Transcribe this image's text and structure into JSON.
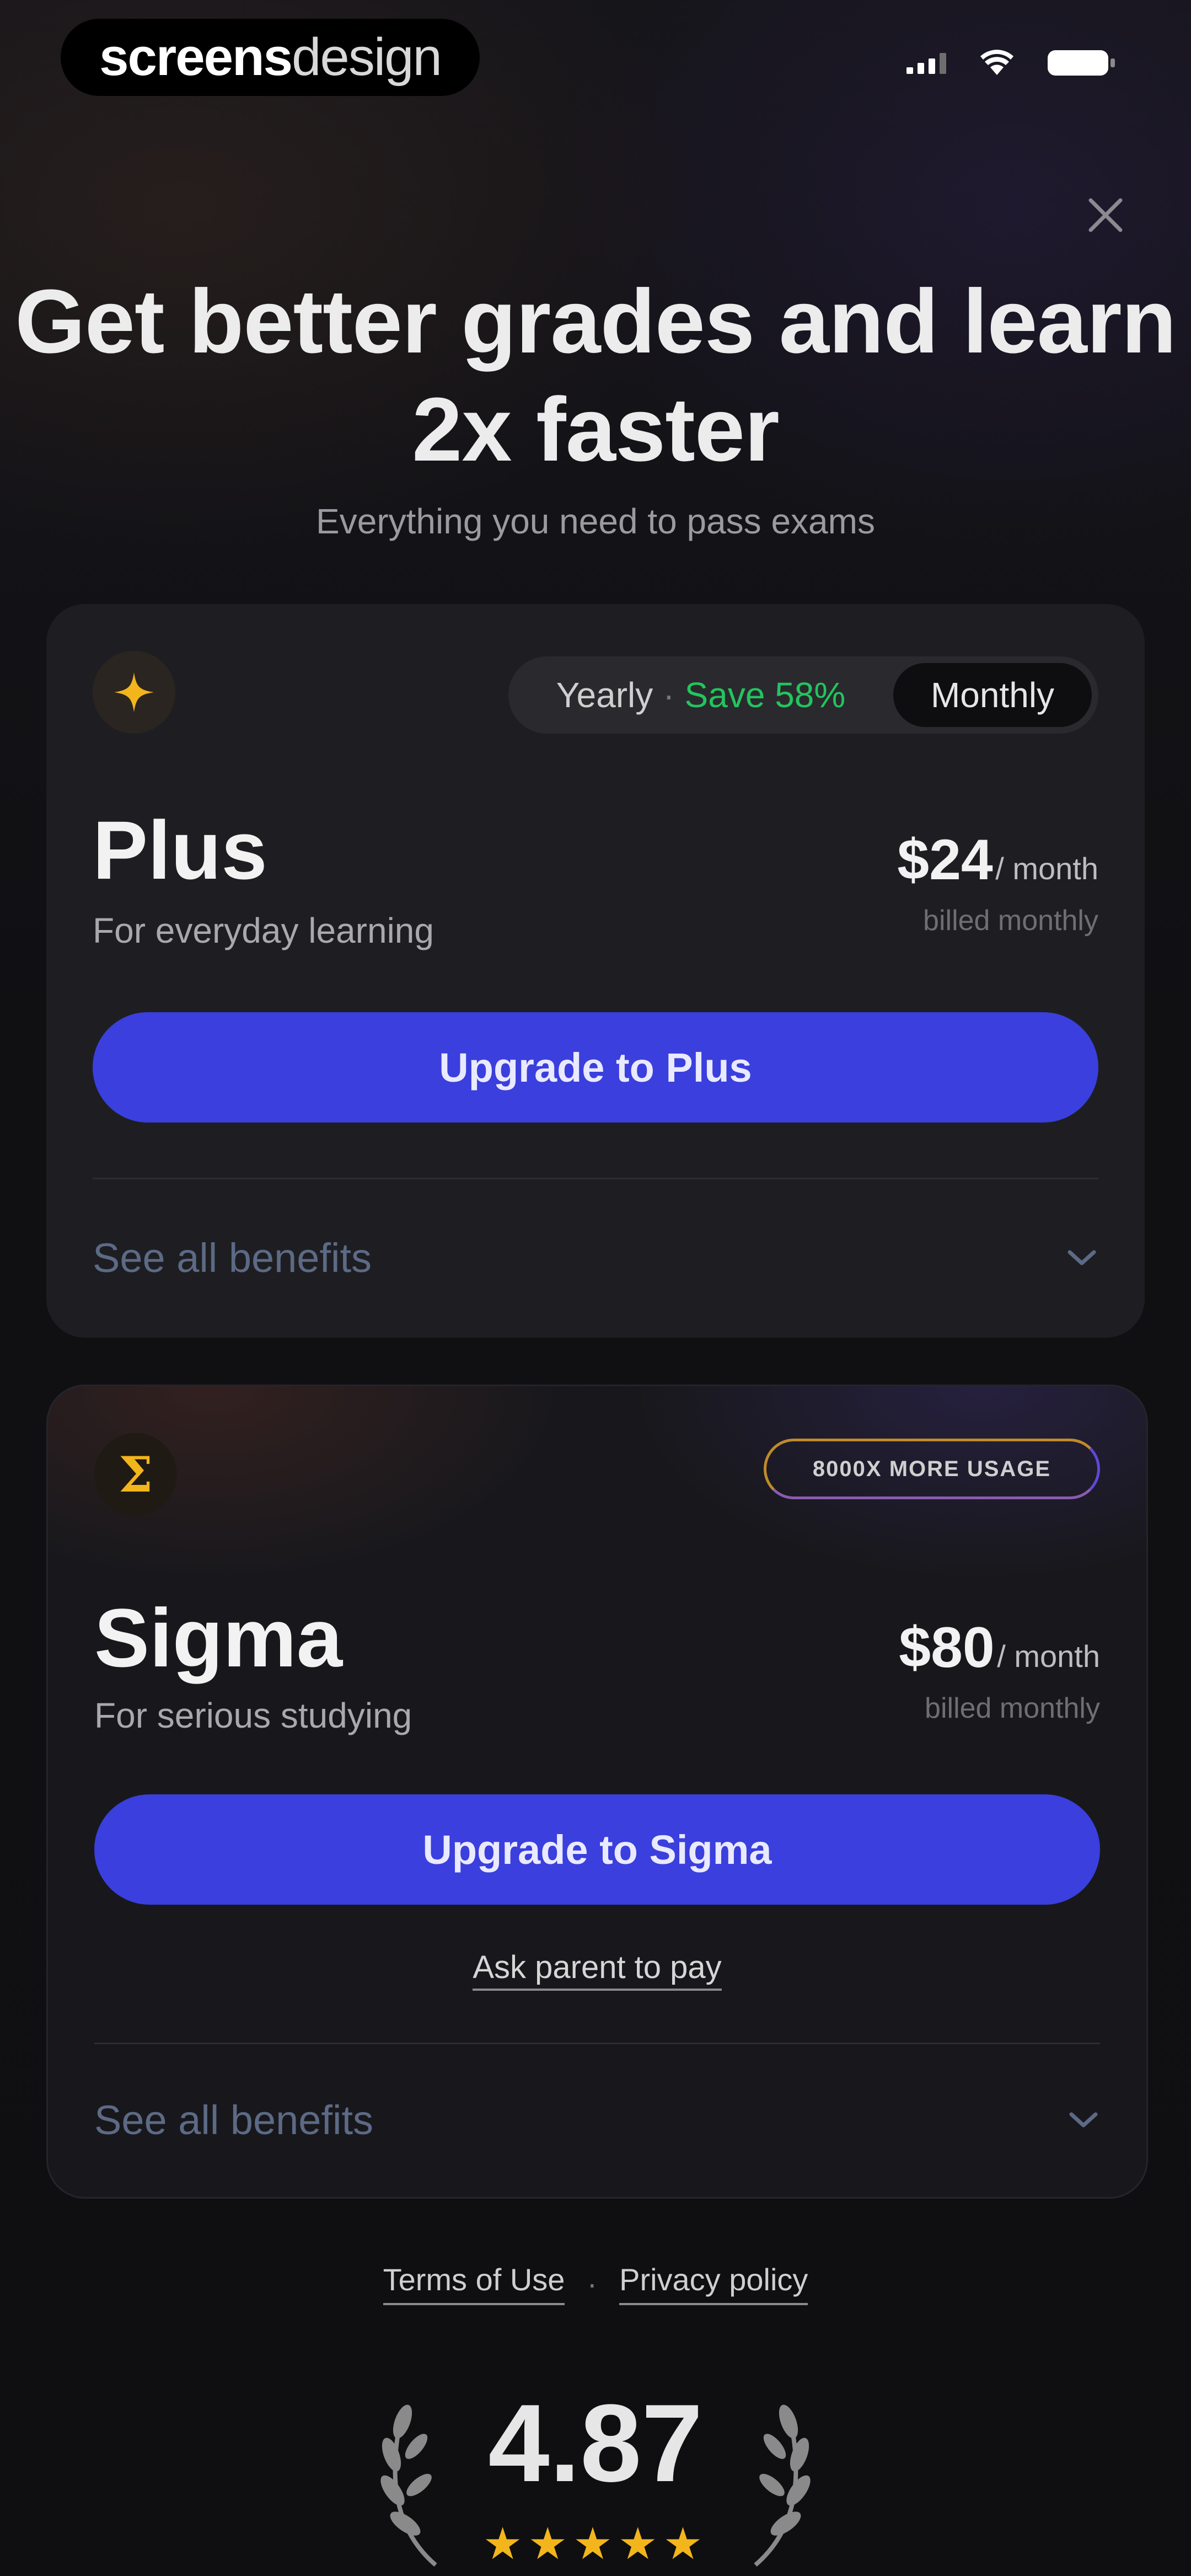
{
  "status_bar": {
    "watermark_bold": "screens",
    "watermark_light": "design"
  },
  "header": {
    "title": "Get better grades and learn 2x faster",
    "subtitle": "Everything you need to pass exams"
  },
  "billing_toggle": {
    "yearly_label": "Yearly",
    "separator": "·",
    "save_label": "Save 58%",
    "monthly_label": "Monthly",
    "selected": "Monthly"
  },
  "plans": [
    {
      "icon": "sparkle-icon",
      "name": "Plus",
      "description": "For everyday learning",
      "price": "$24",
      "period": "/ month",
      "billed": "billed monthly",
      "cta": "Upgrade to Plus",
      "benefits_label": "See all benefits"
    },
    {
      "icon": "sigma-icon",
      "badge": "8000X MORE USAGE",
      "name": "Sigma",
      "description": "For serious studying",
      "price": "$80",
      "period": "/ month",
      "billed": "billed monthly",
      "cta": "Upgrade to Sigma",
      "secondary_link": "Ask parent to pay",
      "benefits_label": "See all benefits"
    }
  ],
  "footer": {
    "terms": "Terms of Use",
    "separator": "·",
    "privacy": "Privacy policy",
    "rating": "4.87",
    "stars": 5
  },
  "colors": {
    "accent": "#3a3fdd",
    "save_green": "#22c55e",
    "gold": "#f3b51c"
  }
}
